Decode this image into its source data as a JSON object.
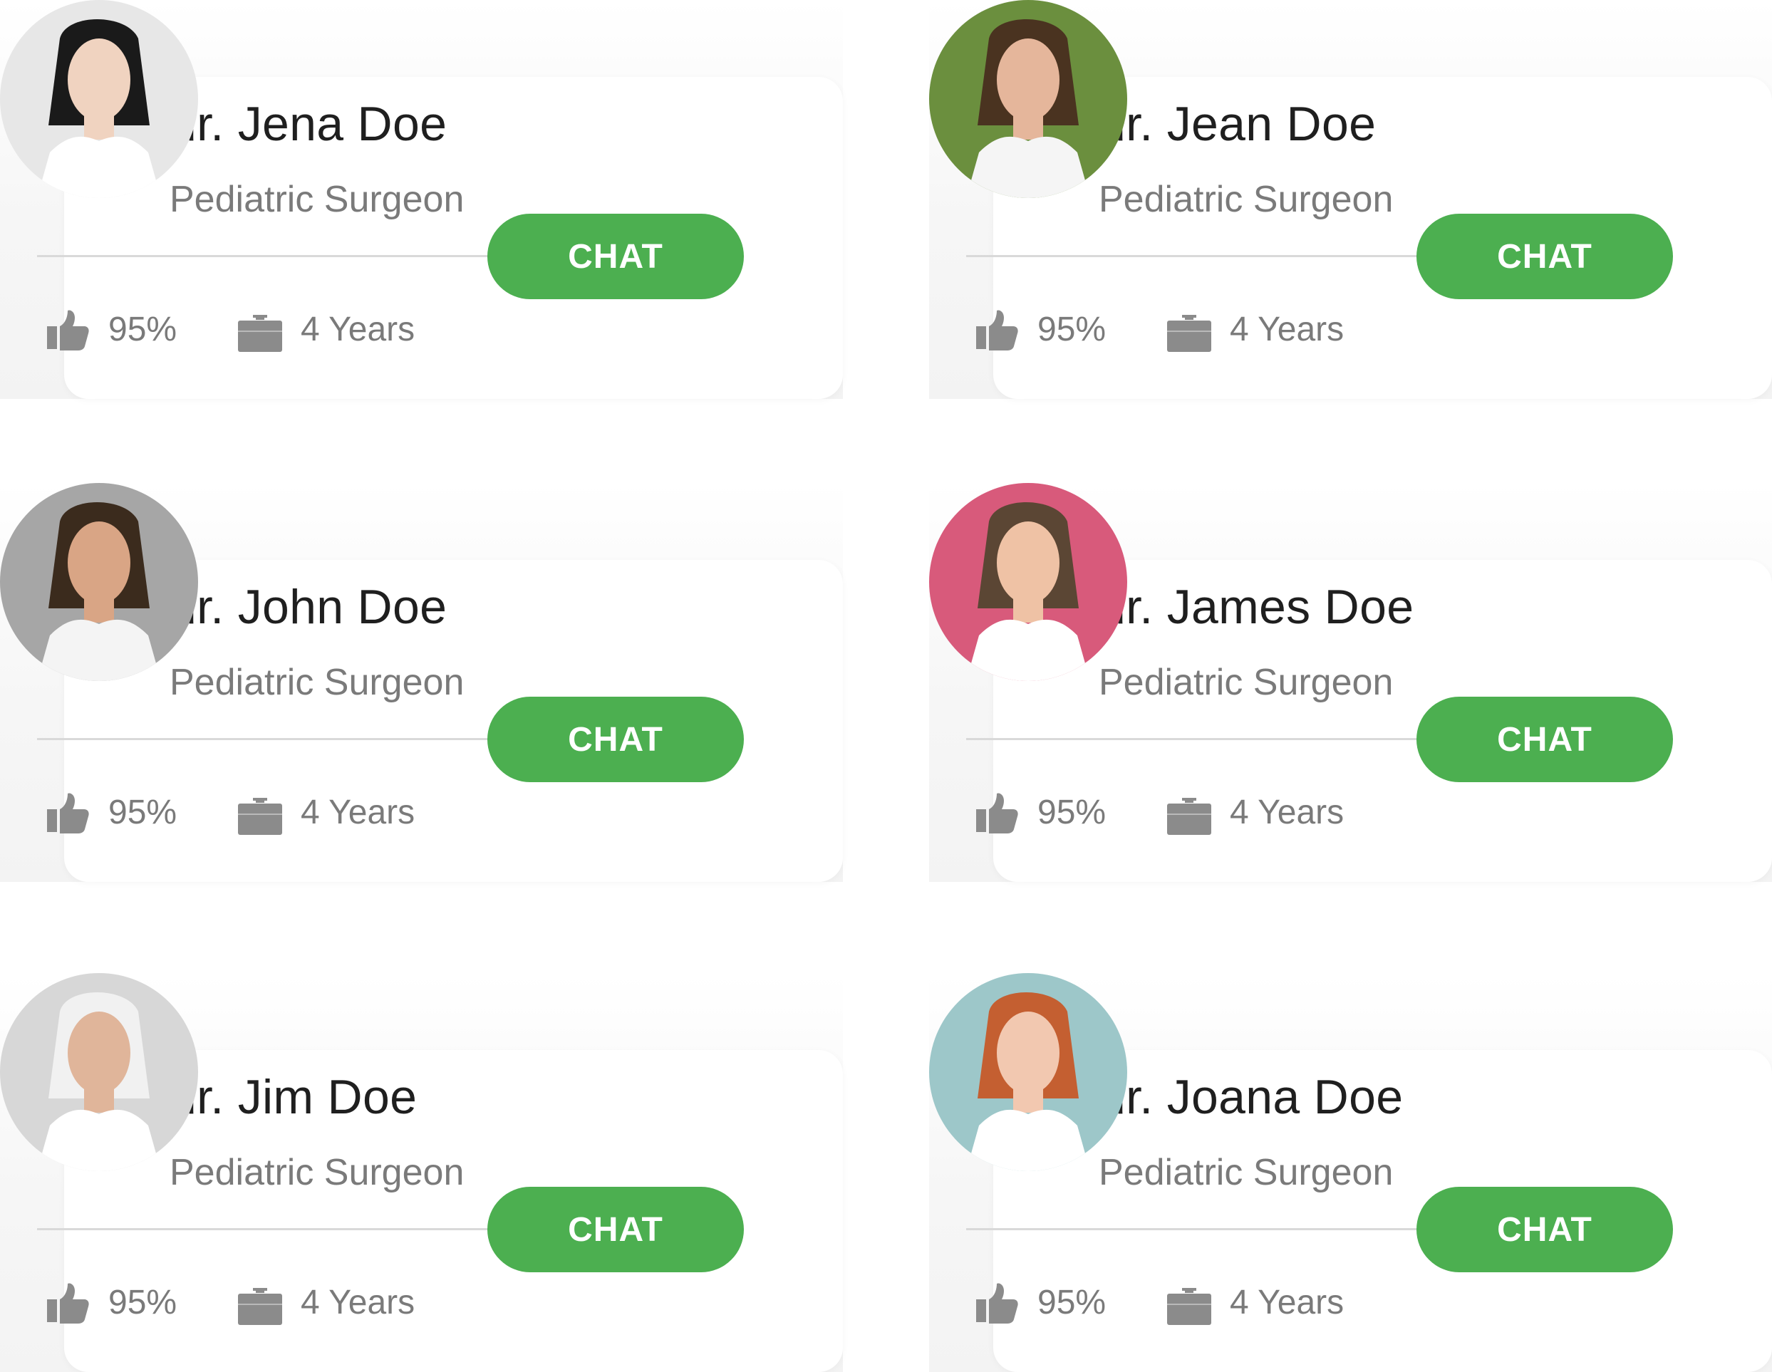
{
  "doctors": [
    {
      "name": "dr. Jena Doe",
      "specialty": "Pediatric Surgeon",
      "rating": "95%",
      "experience": "4 Years",
      "cta": "CHAT",
      "avatar": {
        "background": "#e7e7e7",
        "skin": "#f0d3c0",
        "hair": "#1a1a1a",
        "clothing": "#ffffff"
      }
    },
    {
      "name": "dr. Jean Doe",
      "specialty": "Pediatric Surgeon",
      "rating": "95%",
      "experience": "4 Years",
      "cta": "CHAT",
      "avatar": {
        "background": "#6b8f3e",
        "skin": "#e5b69b",
        "hair": "#4a3320",
        "clothing": "#f5f5f5"
      }
    },
    {
      "name": "dr. John Doe",
      "specialty": "Pediatric Surgeon",
      "rating": "95%",
      "experience": "4 Years",
      "cta": "CHAT",
      "avatar": {
        "background": "#a6a6a6",
        "skin": "#d9a585",
        "hair": "#3b2b1d",
        "clothing": "#f4f4f4"
      }
    },
    {
      "name": "dr. James Doe",
      "specialty": "Pediatric Surgeon",
      "rating": "95%",
      "experience": "4 Years",
      "cta": "CHAT",
      "avatar": {
        "background": "#d85a7b",
        "skin": "#efc2a5",
        "hair": "#5b4634",
        "clothing": "#ffffff"
      }
    },
    {
      "name": "dr. Jim Doe",
      "specialty": "Pediatric Surgeon",
      "rating": "95%",
      "experience": "4 Years",
      "cta": "CHAT",
      "avatar": {
        "background": "#d7d7d7",
        "skin": "#e0b59a",
        "hair": "#f1f1f1",
        "clothing": "#ffffff"
      }
    },
    {
      "name": "dr. Joana Doe",
      "specialty": "Pediatric Surgeon",
      "rating": "95%",
      "experience": "4 Years",
      "cta": "CHAT",
      "avatar": {
        "background": "#9dc7c9",
        "skin": "#f2c8b0",
        "hair": "#c45f31",
        "clothing": "#ffffff"
      }
    }
  ],
  "colors": {
    "accent": "#4caf50",
    "icon": "#8b8b8b",
    "name": "#1f1f1f",
    "secondary": "#7a7a7a",
    "divider": "#d9d9d9"
  },
  "icons": {
    "rating": "thumbs-up-icon",
    "experience": "briefcase-icon"
  }
}
